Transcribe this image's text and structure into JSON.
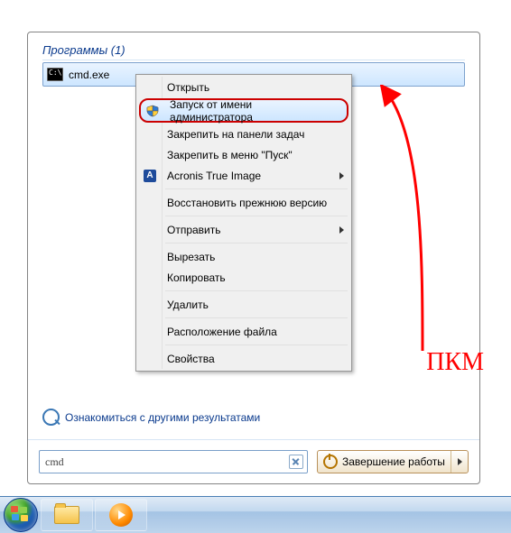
{
  "results": {
    "group_header": "Программы (1)",
    "item_label": "cmd.exe"
  },
  "context_menu": {
    "open": "Открыть",
    "run_as_admin": "Запуск от имени администратора",
    "pin_taskbar": "Закрепить на панели задач",
    "pin_start": "Закрепить в меню \"Пуск\"",
    "acronis": "Acronis True Image",
    "restore_prev": "Восстановить прежнюю версию",
    "send_to": "Отправить",
    "cut": "Вырезать",
    "copy": "Копировать",
    "delete": "Удалить",
    "open_location": "Расположение файла",
    "properties": "Свойства"
  },
  "see_more": "Ознакомиться с другими результатами",
  "search": {
    "value": "cmd"
  },
  "shutdown": {
    "label": "Завершение работы"
  },
  "annotation": "ПКМ"
}
